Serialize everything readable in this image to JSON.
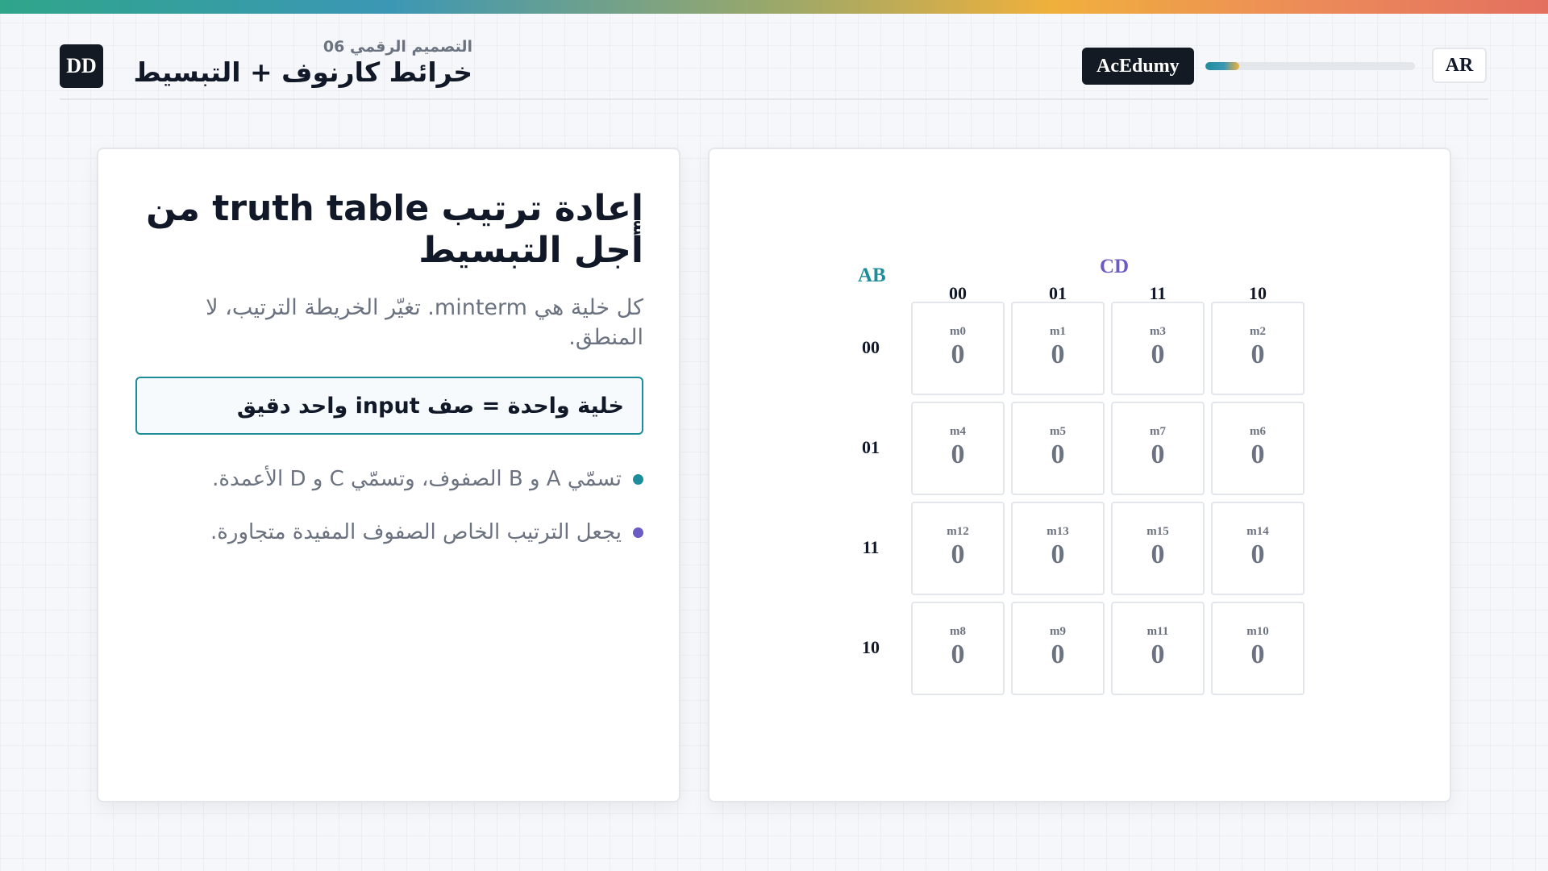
{
  "header": {
    "logo": "DD",
    "subtitle": "التصميم الرقمي 06",
    "title": "خرائط كارنوف + التبسيط",
    "brand": "AcEdumy",
    "progress": 0.16,
    "language": "AR"
  },
  "colors": {
    "ab_accent": "#1e8d9b",
    "cd_accent": "#6b5bc4"
  },
  "left": {
    "heading": "إعادة ترتيب truth table من أجل التبسيط",
    "lead": "كل خلية هي minterm. تغيّر الخريطة الترتيب، لا المنطق.",
    "callout": "خلية واحدة = صف input واحد دقيق",
    "bullets": [
      {
        "text": "تسمّي A و B الصفوف، وتسمّي C و D الأعمدة.",
        "color": "#1e8d9b"
      },
      {
        "text": "يجعل الترتيب الخاص الصفوف المفيدة متجاورة.",
        "color": "#6b5bc4"
      }
    ]
  },
  "kmap": {
    "row_var": "AB",
    "col_var": "CD",
    "col_labels": [
      "00",
      "01",
      "11",
      "10"
    ],
    "rows": [
      {
        "label": "00",
        "cells": [
          {
            "m": "m0",
            "v": "0"
          },
          {
            "m": "m1",
            "v": "0"
          },
          {
            "m": "m3",
            "v": "0"
          },
          {
            "m": "m2",
            "v": "0"
          }
        ]
      },
      {
        "label": "01",
        "cells": [
          {
            "m": "m4",
            "v": "0"
          },
          {
            "m": "m5",
            "v": "0"
          },
          {
            "m": "m7",
            "v": "0"
          },
          {
            "m": "m6",
            "v": "0"
          }
        ]
      },
      {
        "label": "11",
        "cells": [
          {
            "m": "m12",
            "v": "0"
          },
          {
            "m": "m13",
            "v": "0"
          },
          {
            "m": "m15",
            "v": "0"
          },
          {
            "m": "m14",
            "v": "0"
          }
        ]
      },
      {
        "label": "10",
        "cells": [
          {
            "m": "m8",
            "v": "0"
          },
          {
            "m": "m9",
            "v": "0"
          },
          {
            "m": "m11",
            "v": "0"
          },
          {
            "m": "m10",
            "v": "0"
          }
        ]
      }
    ]
  }
}
